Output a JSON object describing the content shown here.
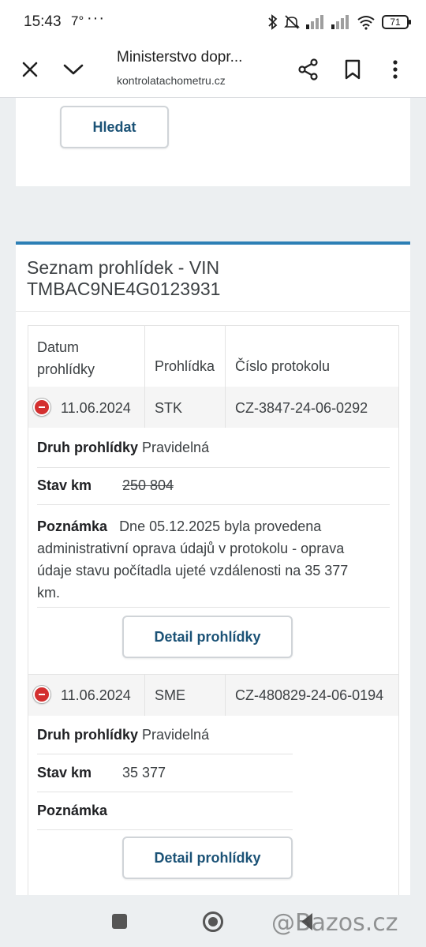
{
  "status_bar": {
    "time": "15:43",
    "temperature": "7°",
    "more": "···",
    "battery": "71"
  },
  "browser": {
    "page_title": "Ministerstvo dopr...",
    "url": "kontrolatachometru.cz"
  },
  "search": {
    "button_label": "Hledat"
  },
  "list": {
    "title_line1": "Seznam prohlídek - VIN",
    "title_line2": "TMBAC9NE4G0123931",
    "columns": {
      "date_line1": "Datum",
      "date_line2": "prohlídky",
      "inspection": "Prohlídka",
      "protocol": "Číslo protokolu"
    },
    "rows": [
      {
        "date": "11.06.2024",
        "type": "STK",
        "protocol": "CZ-3847-24-06-0292",
        "kind_label": "Druh prohlídky",
        "kind_value": "Pravidelná",
        "km_label": "Stav km",
        "km_value": "250 804",
        "note_label": "Poznámka",
        "note_line1": "Dne 05.12.2025 byla provedena",
        "note_line2": "administrativní oprava údajů v protokolu - oprava",
        "note_line3": "údaje stavu počítadla ujeté vzdálenosti na 35 377",
        "note_line4": "km.",
        "detail_button": "Detail prohlídky"
      },
      {
        "date": "11.06.2024",
        "type": "SME",
        "protocol": "CZ-480829-24-06-0194",
        "kind_label": "Druh prohlídky",
        "kind_value": "Pravidelná",
        "km_label": "Stav km",
        "km_value": "35 377",
        "note_label": "Poznámka",
        "detail_button": "Detail prohlídky"
      }
    ]
  },
  "watermark": "@Bazos.cz",
  "colors": {
    "accent": "#2c7fb5",
    "button_text": "#1b5276",
    "remove_icon": "#d32f2f"
  }
}
